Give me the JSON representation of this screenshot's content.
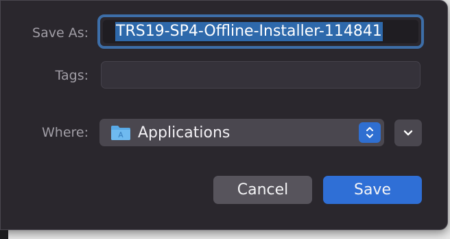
{
  "dialog": {
    "save_as_label": "Save As:",
    "save_as_value": "TRS19-SP4-Offline-Installer-114841",
    "tags_label": "Tags:",
    "tags_value": "",
    "where_label": "Where:",
    "where_value": "Applications",
    "cancel_label": "Cancel",
    "save_label": "Save"
  },
  "colors": {
    "accent": "#2f6fd6",
    "selection": "#2e69ab",
    "focus_ring": "#3d6ea8",
    "dialog_bg": "#2a272d"
  },
  "icons": {
    "where_folder": "folder-icon",
    "where_stepper": "chevron-up-down-icon",
    "expand": "chevron-down-icon"
  }
}
